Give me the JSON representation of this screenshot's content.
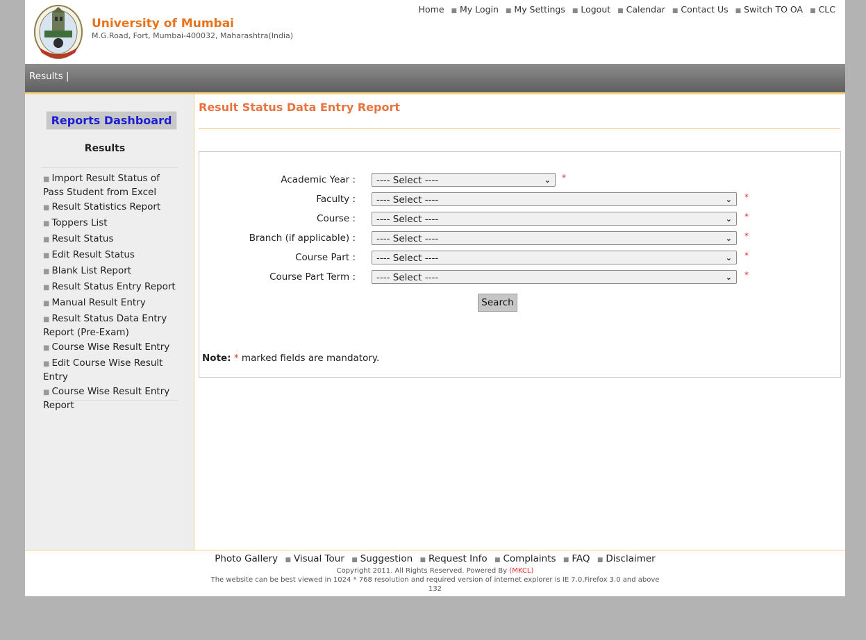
{
  "header": {
    "university_name": "University of Mumbai",
    "address": "M.G.Road, Fort, Mumbai-400032, Maharashtra(India)",
    "top_links": [
      "Home",
      "My Login",
      "My Settings",
      "Logout",
      "Calendar",
      "Contact Us",
      "Switch TO OA",
      "CLC"
    ]
  },
  "navbar": {
    "item": "Results |"
  },
  "sidebar": {
    "dashboard_label": "Reports Dashboard",
    "heading": "Results",
    "items": [
      "Import Result Status of Pass Student from Excel",
      "Result Statistics Report",
      "Toppers List",
      "Result Status",
      "Edit Result Status",
      "Blank List Report",
      "Result Status Entry Report",
      "Manual Result Entry",
      "Result Status Data Entry Report (Pre-Exam)",
      "Course Wise Result Entry",
      "Edit Course Wise Result Entry",
      "Course Wise Result Entry Report"
    ]
  },
  "main": {
    "title": "Result Status Data Entry Report",
    "fields": [
      {
        "label": "Academic Year :",
        "value": "---- Select ----",
        "required_mark": "*"
      },
      {
        "label": "Faculty :",
        "value": "---- Select ----",
        "required_mark": "*"
      },
      {
        "label": "Course :",
        "value": "---- Select ----",
        "required_mark": "*"
      },
      {
        "label": "Branch (if applicable) :",
        "value": "---- Select ----",
        "required_mark": "*"
      },
      {
        "label": "Course Part :",
        "value": "---- Select ----",
        "required_mark": "*"
      },
      {
        "label": "Course Part Term :",
        "value": "---- Select ----",
        "required_mark": "*"
      }
    ],
    "search_label": "Search",
    "note_label": "Note:",
    "note_mark": "*",
    "note_text": " marked fields are mandatory."
  },
  "footer": {
    "links": [
      "Photo Gallery",
      "Visual Tour",
      "Suggestion",
      "Request Info",
      "Complaints",
      "FAQ",
      "Disclaimer"
    ],
    "copyright": "Copyright 2011. All Rights Reserved. Powered By",
    "powered_by": "(MKCL)",
    "browser_note": "The website can be best viewed in 1024 * 768 resolution and required version of internet explorer is IE 7.0,Firefox 3.0 and above",
    "counter": "132"
  },
  "colors": {
    "brand_orange": "#e8731a",
    "title_orange": "#e8733f",
    "required_red": "#e03030",
    "dashboard_blue": "#1d1dd6"
  }
}
